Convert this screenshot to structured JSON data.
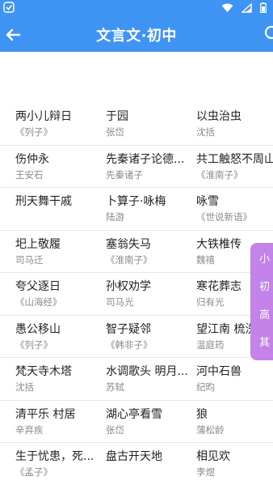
{
  "header": {
    "title": "文言文·初中",
    "bg_color": "#3f93f2"
  },
  "rows": [
    [
      {
        "title": "两小儿辩日",
        "author": "《列子》"
      },
      {
        "title": "于园",
        "author": "张岱"
      },
      {
        "title": "以虫治虫",
        "author": "沈括"
      }
    ],
    [
      {
        "title": "伤仲永",
        "author": "王安石"
      },
      {
        "title": "先秦诸子论德...",
        "author": "先秦诸子"
      },
      {
        "title": "共工触怒不周山",
        "author": "《淮南子》"
      }
    ],
    [
      {
        "title": "刑天舞干戚",
        "author": ""
      },
      {
        "title": "卜算子·咏梅",
        "author": "陆游"
      },
      {
        "title": "咏雪",
        "author": "《世说新语》"
      }
    ],
    [
      {
        "title": "圯上敬履",
        "author": "司马迁"
      },
      {
        "title": "塞翁失马",
        "author": "《淮南子》"
      },
      {
        "title": "大铁椎传",
        "author": "魏禧"
      }
    ],
    [
      {
        "title": "夸父逐日",
        "author": "《山海经》"
      },
      {
        "title": "孙权劝学",
        "author": "司马光"
      },
      {
        "title": "寒花葬志",
        "author": "归有光"
      }
    ],
    [
      {
        "title": "愚公移山",
        "author": "《列子》"
      },
      {
        "title": "智子疑邻",
        "author": "《韩非子》"
      },
      {
        "title": "望江南 梳洗罢",
        "author": "温庭筠"
      }
    ],
    [
      {
        "title": "梵天寺木塔",
        "author": "沈括"
      },
      {
        "title": "水调歌头 明月...",
        "author": "苏轼"
      },
      {
        "title": "河中石兽",
        "author": "纪昀"
      }
    ],
    [
      {
        "title": "清平乐 村居",
        "author": "辛弃疾"
      },
      {
        "title": "湖心亭看雪",
        "author": "张岱"
      },
      {
        "title": "狼",
        "author": "蒲松龄"
      }
    ],
    [
      {
        "title": "生于忧患，死...",
        "author": "《孟子》"
      },
      {
        "title": "盘古开天地",
        "author": ""
      },
      {
        "title": "相见欢",
        "author": "李煜"
      }
    ]
  ],
  "side_index": {
    "items": [
      "小",
      "初",
      "高",
      "其"
    ],
    "color": "#c383e8"
  }
}
